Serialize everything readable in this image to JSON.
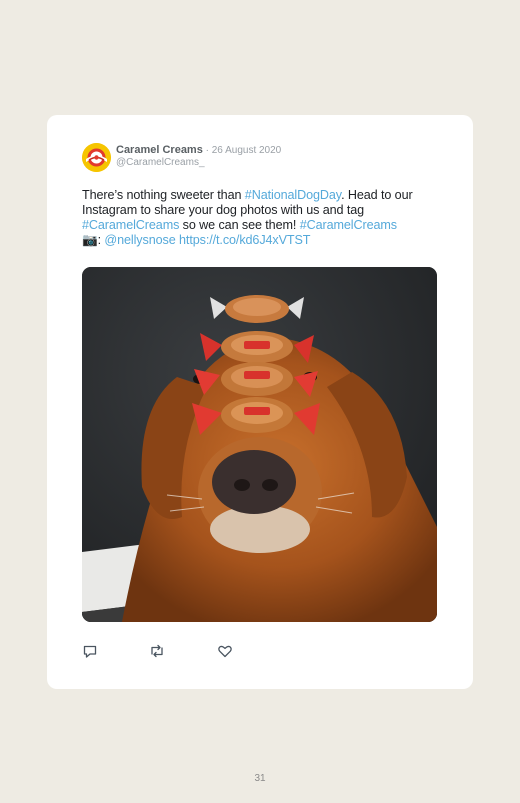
{
  "tweet": {
    "author_name": "Caramel Creams",
    "separator": " · ",
    "date": "26 August 2020",
    "handle": "@CaramelCreams_",
    "text_1": "There’s nothing sweeter than ",
    "hashtag_1": "#NationalDogDay",
    "text_2": ". Head to our Instagram to share your dog photos with us and tag ",
    "hashtag_2": "#CaramelCreams",
    "text_3": " so we can see them! ",
    "hashtag_3": "#CaramelCreams",
    "camera_glyph": "📷",
    "text_4": ": ",
    "mention": "@nellysnose",
    "url": "https://t.co/kd6J4xVTST"
  },
  "icons": {
    "reply": "reply-icon",
    "retweet": "retweet-icon",
    "like": "heart-icon",
    "avatar": "caramel-creams-logo"
  },
  "colors": {
    "link": "#55a9da",
    "background": "#eeebe3",
    "card": "#ffffff"
  },
  "page": {
    "number": "31"
  }
}
